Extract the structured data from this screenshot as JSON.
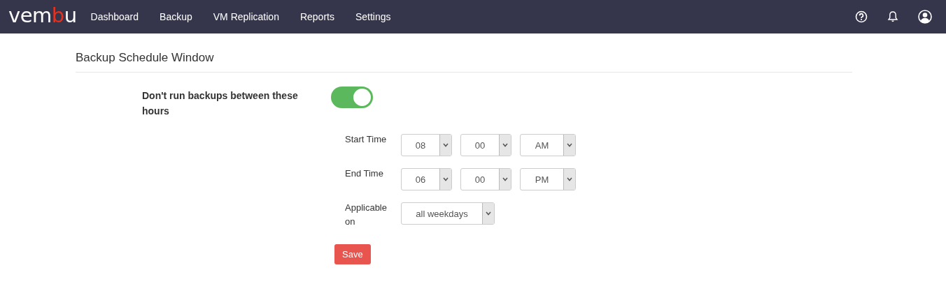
{
  "logo": {
    "parts": [
      {
        "text": "vem",
        "accent": false
      },
      {
        "text": "b",
        "accent": true
      },
      {
        "text": "u",
        "accent": false
      }
    ]
  },
  "nav": [
    {
      "label": "Dashboard"
    },
    {
      "label": "Backup"
    },
    {
      "label": "VM Replication"
    },
    {
      "label": "Reports"
    },
    {
      "label": "Settings"
    }
  ],
  "page_title": "Backup Schedule Window",
  "setting": {
    "label": "Don't run backups between these hours",
    "on": true
  },
  "rows": [
    {
      "label": "Start Time",
      "selects": [
        "08",
        "00",
        "AM"
      ]
    },
    {
      "label": "End Time",
      "selects": [
        "06",
        "00",
        "PM"
      ]
    },
    {
      "label": "Applicable on",
      "selects": [
        "all weekdays"
      ]
    }
  ],
  "save_button": "Save"
}
